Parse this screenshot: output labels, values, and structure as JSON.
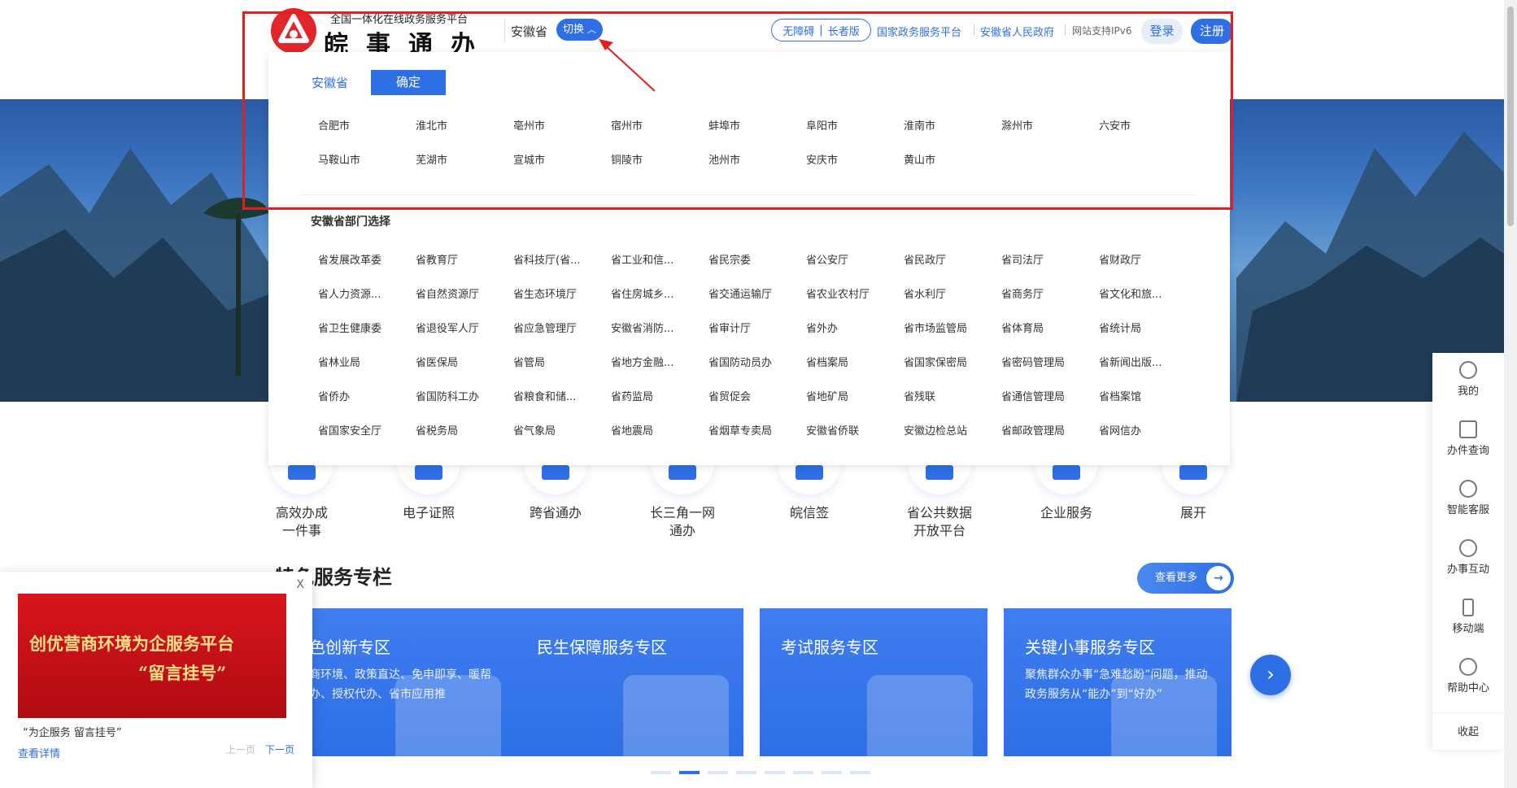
{
  "header": {
    "logo_sub": "全国一体化在线政务服务平台",
    "logo_main": "皖事通办",
    "province": "安徽省",
    "switch_label": "切换",
    "accessibility": "无障碍",
    "elder": "长者版",
    "links": [
      "国家政务服务平台",
      "安徽省人民政府"
    ],
    "ipv6": "网站支持IPv6",
    "login": "登录",
    "register": "注册"
  },
  "popup": {
    "province_tab": "安徽省",
    "confirm": "确定",
    "cities": [
      "合肥市",
      "淮北市",
      "亳州市",
      "宿州市",
      "蚌埠市",
      "阜阳市",
      "淮南市",
      "滁州市",
      "六安市",
      "马鞍山市",
      "芜湖市",
      "宣城市",
      "铜陵市",
      "池州市",
      "安庆市",
      "黄山市"
    ],
    "dept_title": "安徽省部门选择",
    "departments": [
      "省发展改革委",
      "省教育厅",
      "省科技厅(省...",
      "省工业和信...",
      "省民宗委",
      "省公安厅",
      "省民政厅",
      "省司法厅",
      "省财政厅",
      "省人力资源...",
      "省自然资源厅",
      "省生态环境厅",
      "省住房城乡...",
      "省交通运输厅",
      "省农业农村厅",
      "省水利厅",
      "省商务厅",
      "省文化和旅...",
      "省卫生健康委",
      "省退役军人厅",
      "省应急管理厅",
      "安徽省消防...",
      "省审计厅",
      "省外办",
      "省市场监管局",
      "省体育局",
      "省统计局",
      "省林业局",
      "省医保局",
      "省管局",
      "省地方金融...",
      "省国防动员办",
      "省档案局",
      "省国家保密局",
      "省密码管理局",
      "省新闻出版...",
      "省侨办",
      "省国防科工办",
      "省粮食和储...",
      "省药监局",
      "省贸促会",
      "省地矿局",
      "省残联",
      "省通信管理局",
      "省档案馆",
      "省国家安全厅",
      "省税务局",
      "省气象局",
      "省地震局",
      "省烟草专卖局",
      "安徽省侨联",
      "安徽边检总站",
      "省邮政管理局",
      "省网信办"
    ]
  },
  "services": [
    {
      "label": "高效办成\n一件事"
    },
    {
      "label": "电子证照"
    },
    {
      "label": "跨省通办"
    },
    {
      "label": "长三角一网\n通办"
    },
    {
      "label": "皖信签"
    },
    {
      "label": "省公共数据\n开放平台"
    },
    {
      "label": "企业服务"
    },
    {
      "label": "展开"
    }
  ],
  "section": {
    "title": "特色服务专栏",
    "more": "查看更多"
  },
  "cards": [
    {
      "title": "色创新专区",
      "desc": "商环境、政策直达、免申即享、暖帮办、授权代办、省市应用推"
    },
    {
      "title": "民生保障服务专区",
      "desc": ""
    },
    {
      "title": "考试服务专区",
      "desc": ""
    },
    {
      "title": "关键小事服务专区",
      "desc": "聚焦群众办事“急难愁盼”问题，推动政务服务从“能办”到“好办”"
    }
  ],
  "notice": {
    "close": "X",
    "banner_line1": "创优营商环境为企服务平台",
    "banner_line2": "“留言挂号”",
    "caption": "“为企服务 留言挂号”",
    "detail": "查看详情",
    "prev": "上一页",
    "next": "下一页"
  },
  "rightbar": [
    "我的",
    "办件查询",
    "智能客服",
    "办事互动",
    "移动端",
    "帮助中心",
    "收起"
  ]
}
